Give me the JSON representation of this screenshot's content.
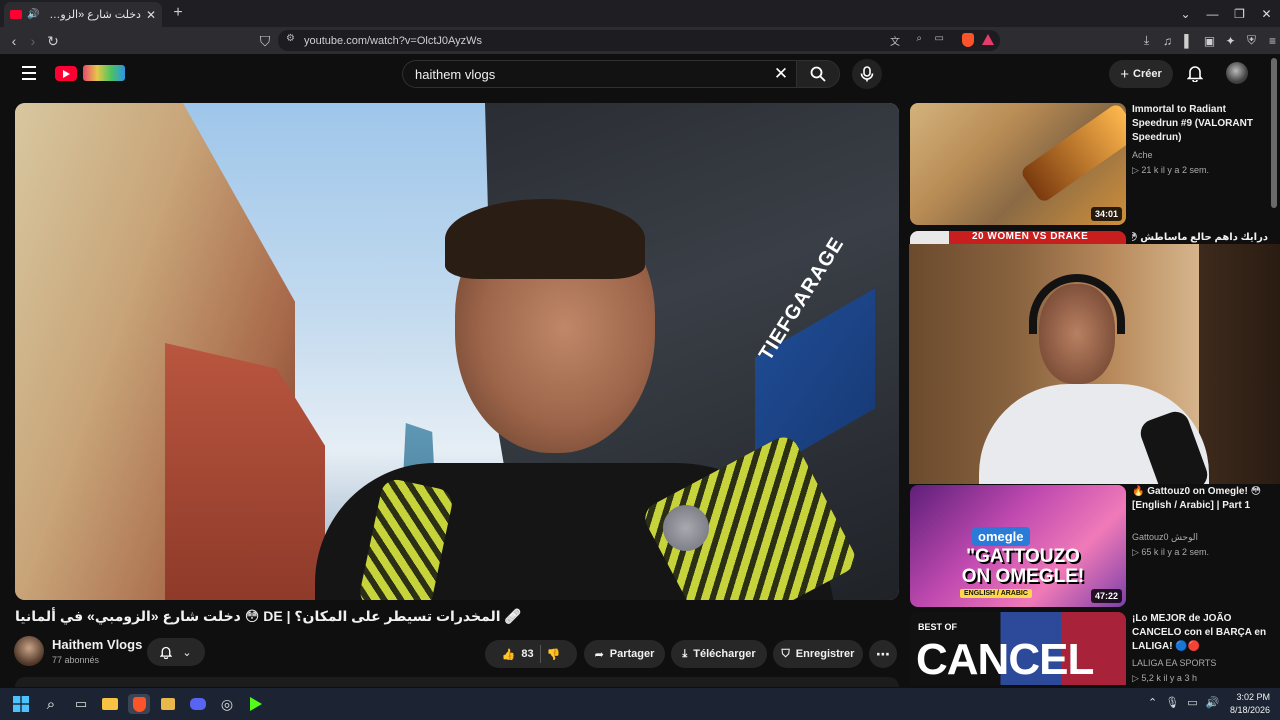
{
  "browser": {
    "tab_title": "دخلت شارع «الزومبي» في ألمانيا",
    "url": "youtube.com/watch?v=OlctJ0AyzWs"
  },
  "youtube": {
    "search_value": "haithem vlogs",
    "create_label": "Créer"
  },
  "video": {
    "title": "🩹 المخدرات تسيطر على المكان؟ | DE 😳 دخلت شارع «الزومبي» في ألمانيا",
    "channel": "Haithem Vlogs",
    "subscribers": "77 abonnés",
    "likes": "83",
    "share_label": "Partager",
    "download_label": "Télécharger",
    "save_label": "Enregistrer"
  },
  "overlay": {
    "sign_text": "TIEFGARAGE"
  },
  "recommendations": [
    {
      "title": "Immortal to Radiant Speedrun #9 (VALORANT Speedrun)",
      "channel": "Ache",
      "meta": "▷ 21 k  il y a 2 sem.",
      "duration": "34:01"
    },
    {
      "title": "درايك داهم حالع ماساطش 😳 ||",
      "banner": "20 WOMEN VS DRAKE"
    },
    {
      "title": "🔥 Gattouz0 on Omegle! 😳 [English / Arabic] | Part 1",
      "channel": "Gattouz0 الوحش",
      "meta": "▷ 65 k  il y a 2 sem.",
      "duration": "47:22",
      "thumb_logo": "omegle",
      "thumb_big": "\"GATTOUZO ON OMEGLE!",
      "thumb_tag": "ENGLISH / ARABIC"
    },
    {
      "title": "¡Lo MEJOR de JOÃO CANCELO con el BARÇA en LALIGA! 🔵🔴",
      "channel": "LALIGA EA SPORTS",
      "meta": "▷ 5,2 k  il y a 3 h",
      "thumb_top": "BEST OF",
      "thumb_big": "CANCEL"
    }
  ],
  "taskbar": {
    "time": "3:02 PM",
    "date": "8/18/2026"
  }
}
